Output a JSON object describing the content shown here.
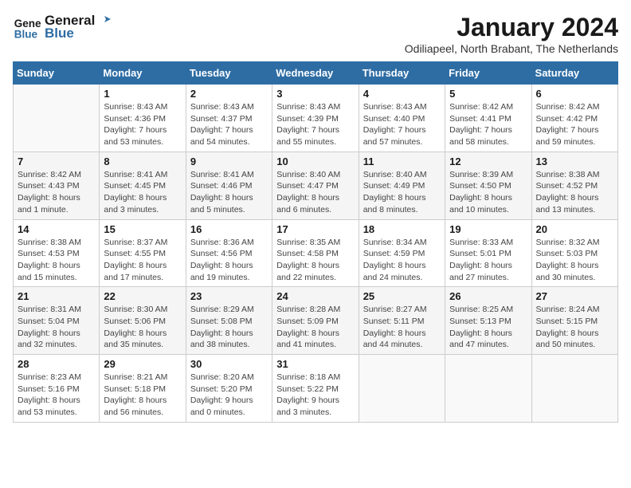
{
  "logo": {
    "line1": "General",
    "line2": "Blue"
  },
  "title": "January 2024",
  "subtitle": "Odiliapeel, North Brabant, The Netherlands",
  "days_of_week": [
    "Sunday",
    "Monday",
    "Tuesday",
    "Wednesday",
    "Thursday",
    "Friday",
    "Saturday"
  ],
  "weeks": [
    [
      {
        "day": "",
        "sunrise": "",
        "sunset": "",
        "daylight": ""
      },
      {
        "day": "1",
        "sunrise": "Sunrise: 8:43 AM",
        "sunset": "Sunset: 4:36 PM",
        "daylight": "Daylight: 7 hours and 53 minutes."
      },
      {
        "day": "2",
        "sunrise": "Sunrise: 8:43 AM",
        "sunset": "Sunset: 4:37 PM",
        "daylight": "Daylight: 7 hours and 54 minutes."
      },
      {
        "day": "3",
        "sunrise": "Sunrise: 8:43 AM",
        "sunset": "Sunset: 4:39 PM",
        "daylight": "Daylight: 7 hours and 55 minutes."
      },
      {
        "day": "4",
        "sunrise": "Sunrise: 8:43 AM",
        "sunset": "Sunset: 4:40 PM",
        "daylight": "Daylight: 7 hours and 57 minutes."
      },
      {
        "day": "5",
        "sunrise": "Sunrise: 8:42 AM",
        "sunset": "Sunset: 4:41 PM",
        "daylight": "Daylight: 7 hours and 58 minutes."
      },
      {
        "day": "6",
        "sunrise": "Sunrise: 8:42 AM",
        "sunset": "Sunset: 4:42 PM",
        "daylight": "Daylight: 7 hours and 59 minutes."
      }
    ],
    [
      {
        "day": "7",
        "sunrise": "Sunrise: 8:42 AM",
        "sunset": "Sunset: 4:43 PM",
        "daylight": "Daylight: 8 hours and 1 minute."
      },
      {
        "day": "8",
        "sunrise": "Sunrise: 8:41 AM",
        "sunset": "Sunset: 4:45 PM",
        "daylight": "Daylight: 8 hours and 3 minutes."
      },
      {
        "day": "9",
        "sunrise": "Sunrise: 8:41 AM",
        "sunset": "Sunset: 4:46 PM",
        "daylight": "Daylight: 8 hours and 5 minutes."
      },
      {
        "day": "10",
        "sunrise": "Sunrise: 8:40 AM",
        "sunset": "Sunset: 4:47 PM",
        "daylight": "Daylight: 8 hours and 6 minutes."
      },
      {
        "day": "11",
        "sunrise": "Sunrise: 8:40 AM",
        "sunset": "Sunset: 4:49 PM",
        "daylight": "Daylight: 8 hours and 8 minutes."
      },
      {
        "day": "12",
        "sunrise": "Sunrise: 8:39 AM",
        "sunset": "Sunset: 4:50 PM",
        "daylight": "Daylight: 8 hours and 10 minutes."
      },
      {
        "day": "13",
        "sunrise": "Sunrise: 8:38 AM",
        "sunset": "Sunset: 4:52 PM",
        "daylight": "Daylight: 8 hours and 13 minutes."
      }
    ],
    [
      {
        "day": "14",
        "sunrise": "Sunrise: 8:38 AM",
        "sunset": "Sunset: 4:53 PM",
        "daylight": "Daylight: 8 hours and 15 minutes."
      },
      {
        "day": "15",
        "sunrise": "Sunrise: 8:37 AM",
        "sunset": "Sunset: 4:55 PM",
        "daylight": "Daylight: 8 hours and 17 minutes."
      },
      {
        "day": "16",
        "sunrise": "Sunrise: 8:36 AM",
        "sunset": "Sunset: 4:56 PM",
        "daylight": "Daylight: 8 hours and 19 minutes."
      },
      {
        "day": "17",
        "sunrise": "Sunrise: 8:35 AM",
        "sunset": "Sunset: 4:58 PM",
        "daylight": "Daylight: 8 hours and 22 minutes."
      },
      {
        "day": "18",
        "sunrise": "Sunrise: 8:34 AM",
        "sunset": "Sunset: 4:59 PM",
        "daylight": "Daylight: 8 hours and 24 minutes."
      },
      {
        "day": "19",
        "sunrise": "Sunrise: 8:33 AM",
        "sunset": "Sunset: 5:01 PM",
        "daylight": "Daylight: 8 hours and 27 minutes."
      },
      {
        "day": "20",
        "sunrise": "Sunrise: 8:32 AM",
        "sunset": "Sunset: 5:03 PM",
        "daylight": "Daylight: 8 hours and 30 minutes."
      }
    ],
    [
      {
        "day": "21",
        "sunrise": "Sunrise: 8:31 AM",
        "sunset": "Sunset: 5:04 PM",
        "daylight": "Daylight: 8 hours and 32 minutes."
      },
      {
        "day": "22",
        "sunrise": "Sunrise: 8:30 AM",
        "sunset": "Sunset: 5:06 PM",
        "daylight": "Daylight: 8 hours and 35 minutes."
      },
      {
        "day": "23",
        "sunrise": "Sunrise: 8:29 AM",
        "sunset": "Sunset: 5:08 PM",
        "daylight": "Daylight: 8 hours and 38 minutes."
      },
      {
        "day": "24",
        "sunrise": "Sunrise: 8:28 AM",
        "sunset": "Sunset: 5:09 PM",
        "daylight": "Daylight: 8 hours and 41 minutes."
      },
      {
        "day": "25",
        "sunrise": "Sunrise: 8:27 AM",
        "sunset": "Sunset: 5:11 PM",
        "daylight": "Daylight: 8 hours and 44 minutes."
      },
      {
        "day": "26",
        "sunrise": "Sunrise: 8:25 AM",
        "sunset": "Sunset: 5:13 PM",
        "daylight": "Daylight: 8 hours and 47 minutes."
      },
      {
        "day": "27",
        "sunrise": "Sunrise: 8:24 AM",
        "sunset": "Sunset: 5:15 PM",
        "daylight": "Daylight: 8 hours and 50 minutes."
      }
    ],
    [
      {
        "day": "28",
        "sunrise": "Sunrise: 8:23 AM",
        "sunset": "Sunset: 5:16 PM",
        "daylight": "Daylight: 8 hours and 53 minutes."
      },
      {
        "day": "29",
        "sunrise": "Sunrise: 8:21 AM",
        "sunset": "Sunset: 5:18 PM",
        "daylight": "Daylight: 8 hours and 56 minutes."
      },
      {
        "day": "30",
        "sunrise": "Sunrise: 8:20 AM",
        "sunset": "Sunset: 5:20 PM",
        "daylight": "Daylight: 9 hours and 0 minutes."
      },
      {
        "day": "31",
        "sunrise": "Sunrise: 8:18 AM",
        "sunset": "Sunset: 5:22 PM",
        "daylight": "Daylight: 9 hours and 3 minutes."
      },
      {
        "day": "",
        "sunrise": "",
        "sunset": "",
        "daylight": ""
      },
      {
        "day": "",
        "sunrise": "",
        "sunset": "",
        "daylight": ""
      },
      {
        "day": "",
        "sunrise": "",
        "sunset": "",
        "daylight": ""
      }
    ]
  ]
}
